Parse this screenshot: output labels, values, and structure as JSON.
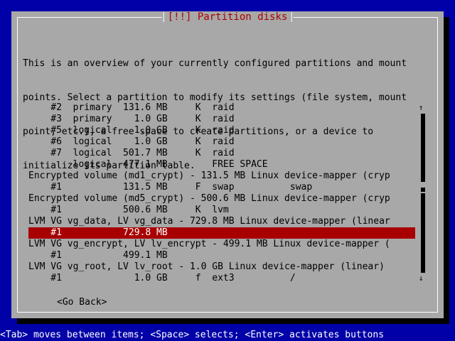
{
  "dialog": {
    "title": "[!!] Partition disks",
    "intro_lines": [
      "This is an overview of your currently configured partitions and mount",
      "points. Select a partition to modify its settings (file system, mount",
      "point, etc.), a free space to create partitions, or a device to",
      "initialize its partition table."
    ],
    "rows": [
      "    #2  primary  131.6 MB     K  raid",
      "    #3  primary    1.0 GB     K  raid",
      "    #5  logical    1.0 GB     K  raid",
      "    #6  logical    1.0 GB     K  raid",
      "    #7  logical  501.7 MB     K  raid",
      "        logical  477.1 MB        FREE SPACE",
      "Encrypted volume (md1_crypt) - 131.5 MB Linux device-mapper (cryp",
      "    #1           131.5 MB     F  swap          swap",
      "Encrypted volume (md5_crypt) - 500.6 MB Linux device-mapper (cryp",
      "    #1           500.6 MB     K  lvm",
      "LVM VG vg_data, LV vg_data - 729.8 MB Linux device-mapper (linear",
      "    #1           729.8 MB",
      "LVM VG vg_encrypt, LV lv_encrypt - 499.1 MB Linux device-mapper (",
      "    #1           499.1 MB",
      "LVM VG vg_root, LV lv_root - 1.0 GB Linux device-mapper (linear)",
      "    #1             1.0 GB     f  ext3          /"
    ],
    "selected_index": 11,
    "go_back": "<Go Back>"
  },
  "scroll": {
    "up": "↑",
    "down": "↓"
  },
  "statusbar": {
    "text": "<Tab> moves between items; <Space> selects; <Enter> activates buttons"
  },
  "colors": {
    "background": "#0000a8",
    "dialog": "#a8a8a8",
    "title": "#a80000",
    "selection": "#a80000"
  }
}
